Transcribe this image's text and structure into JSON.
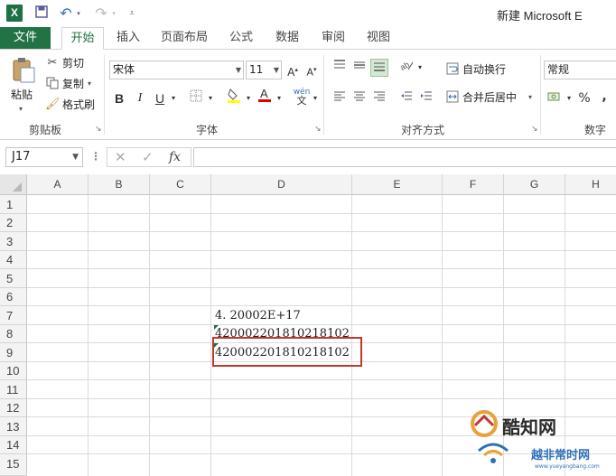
{
  "titlebar": {
    "logo": "X",
    "title": "新建 Microsoft E",
    "qa_undo": "↶",
    "qa_redo": "↷"
  },
  "tabs": [
    {
      "label": "文件"
    },
    {
      "label": "开始"
    },
    {
      "label": "插入"
    },
    {
      "label": "页面布局"
    },
    {
      "label": "公式"
    },
    {
      "label": "数据"
    },
    {
      "label": "审阅"
    },
    {
      "label": "视图"
    }
  ],
  "ribbon": {
    "clipboard": {
      "paste": "粘贴",
      "cut": "剪切",
      "copy": "复制",
      "format_painter": "格式刷",
      "group_label": "剪贴板"
    },
    "font": {
      "font_name": "宋体",
      "font_size": "11",
      "bold": "B",
      "italic": "I",
      "underline": "U",
      "group_label": "字体"
    },
    "alignment": {
      "wrap_text": "自动换行",
      "merge_center": "合并后居中",
      "group_label": "对齐方式"
    },
    "number": {
      "format": "常规",
      "percent": "%",
      "comma": ",",
      "group_label": "数字"
    }
  },
  "formula_bar": {
    "name_box": "J17",
    "fx": "fx",
    "content": ""
  },
  "sheet": {
    "columns": [
      "A",
      "B",
      "C",
      "D",
      "E",
      "F",
      "G",
      "H"
    ],
    "rows": [
      "1",
      "2",
      "3",
      "4",
      "5",
      "6",
      "7",
      "8",
      "9",
      "10",
      "11",
      "12",
      "13",
      "14",
      "15"
    ],
    "cells": {
      "D7": "4. 20002E+17",
      "D8": "420002201810218102",
      "D9": "420002201810218102"
    }
  },
  "watermark": {
    "text1": "酷知网",
    "text2": "越非常时网",
    "url": "www.yueyangbang.com"
  },
  "colors": {
    "excel_green": "#217346",
    "highlight_red": "#c0392b"
  }
}
